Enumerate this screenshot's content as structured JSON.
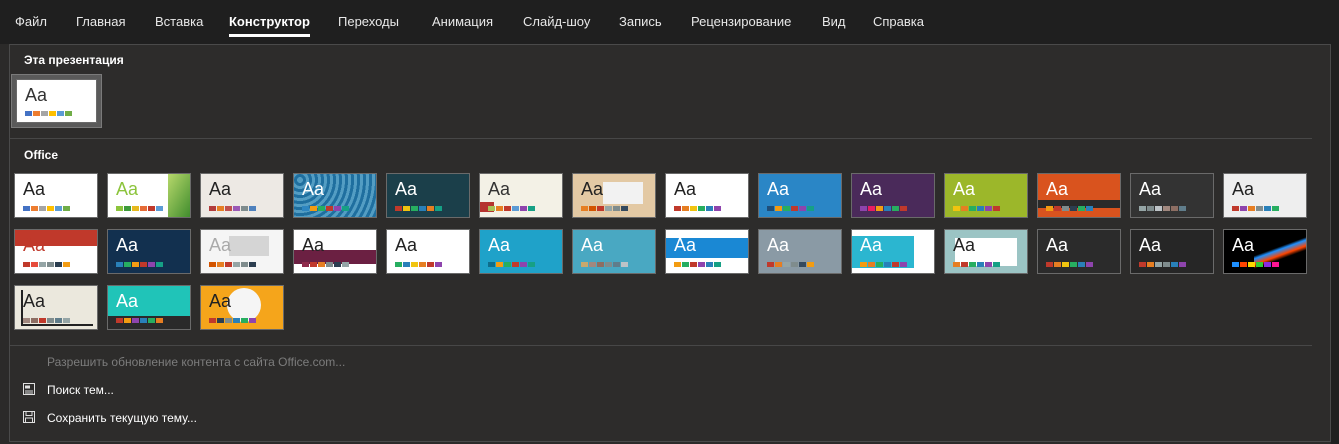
{
  "ribbon": {
    "tabs": [
      {
        "label": "Файл",
        "active": false
      },
      {
        "label": "Главная",
        "active": false
      },
      {
        "label": "Вставка",
        "active": false
      },
      {
        "label": "Конструктор",
        "active": true
      },
      {
        "label": "Переходы",
        "active": false
      },
      {
        "label": "Анимация",
        "active": false
      },
      {
        "label": "Слайд-шоу",
        "active": false
      },
      {
        "label": "Запись",
        "active": false
      },
      {
        "label": "Рецензирование",
        "active": false
      },
      {
        "label": "Вид",
        "active": false
      },
      {
        "label": "Справка",
        "active": false
      }
    ]
  },
  "gallery": {
    "this_presentation": {
      "title": "Эта презентация",
      "theme": {
        "bg": "#ffffff",
        "fg": "#333333",
        "accents": [
          "#4472c4",
          "#ed7d31",
          "#a5a5a5",
          "#ffc000",
          "#5b9bd5",
          "#70ad47"
        ]
      }
    },
    "office": {
      "title": "Office",
      "themes": [
        {
          "bg": "#ffffff",
          "fg": "#222222",
          "accents": [
            "#4472c4",
            "#ed7d31",
            "#a5a5a5",
            "#ffc000",
            "#5b9bd5",
            "#70ad47"
          ]
        },
        {
          "bg": "#ffffff",
          "fg": "#8cc43c",
          "accents": [
            "#8cc43c",
            "#3e9b3a",
            "#e6b91e",
            "#e66c37",
            "#c0392b",
            "#5b9bd5"
          ],
          "deco": "green-right"
        },
        {
          "bg": "#ede9e4",
          "fg": "#222222",
          "accents": [
            "#b23c3c",
            "#e67e22",
            "#c0504d",
            "#9b59b6",
            "#7f8c8d",
            "#4f81bd"
          ]
        },
        {
          "bg": "#1f6f9f",
          "fg": "#ffffff",
          "accents": [
            "#2e86c1",
            "#f39c12",
            "#27ae60",
            "#c0392b",
            "#8e44ad",
            "#16a085"
          ],
          "deco": "pattern-blue"
        },
        {
          "bg": "#1b3f4a",
          "fg": "#ffffff",
          "accents": [
            "#c0392b",
            "#f1c40f",
            "#27ae60",
            "#2980b9",
            "#e67e22",
            "#16a085"
          ]
        },
        {
          "bg": "#f3f1e6",
          "fg": "#333333",
          "accents": [
            "#a8c256",
            "#e67e22",
            "#c0392b",
            "#5b9bd5",
            "#8e44ad",
            "#16a085"
          ],
          "deco": "red-left"
        },
        {
          "bg": "#e3c9a4",
          "fg": "#222222",
          "accents": [
            "#e67e22",
            "#d35400",
            "#c0392b",
            "#95a5a6",
            "#7f8c8d",
            "#34495e"
          ],
          "deco": "gray-band"
        },
        {
          "bg": "#ffffff",
          "fg": "#222222",
          "accents": [
            "#c0392b",
            "#e67e22",
            "#f1c40f",
            "#27ae60",
            "#2980b9",
            "#8e44ad"
          ]
        },
        {
          "bg": "#2a86c6",
          "fg": "#ffffff",
          "accents": [
            "#1f4e79",
            "#f39c12",
            "#27ae60",
            "#c0392b",
            "#8e44ad",
            "#16a085"
          ]
        },
        {
          "bg": "#4a2a5a",
          "fg": "#ffffff",
          "accents": [
            "#8e44ad",
            "#e91e63",
            "#f39c12",
            "#2980b9",
            "#27ae60",
            "#c0392b"
          ]
        },
        {
          "bg": "#9cb72a",
          "fg": "#ffffff",
          "accents": [
            "#f1c40f",
            "#e67e22",
            "#27ae60",
            "#2980b9",
            "#8e44ad",
            "#c0392b"
          ]
        },
        {
          "bg": "#d9531e",
          "fg": "#ffffff",
          "accents": [
            "#f39c12",
            "#c0392b",
            "#7f8c8d",
            "#2c3e50",
            "#27ae60",
            "#2980b9"
          ],
          "deco": "dark-band"
        },
        {
          "bg": "#333333",
          "fg": "#ffffff",
          "accents": [
            "#95a5a6",
            "#7f8c8d",
            "#bdc3c7",
            "#a1887f",
            "#8d6e63",
            "#607d8b"
          ]
        },
        {
          "bg": "#eeeeee",
          "fg": "#222222",
          "accents": [
            "#c0392b",
            "#8e44ad",
            "#e67e22",
            "#7f8c8d",
            "#2980b9",
            "#27ae60"
          ]
        },
        {
          "bg": "#ffffff",
          "fg": "#c0392b",
          "accents": [
            "#c0392b",
            "#e74c3c",
            "#95a5a6",
            "#7f8c8d",
            "#2c3e50",
            "#f39c12"
          ],
          "deco": "red-block"
        },
        {
          "bg": "#12304f",
          "fg": "#ffffff",
          "accents": [
            "#2980b9",
            "#27ae60",
            "#f39c12",
            "#c0392b",
            "#8e44ad",
            "#16a085"
          ]
        },
        {
          "bg": "#f5f5f5",
          "fg": "#aaaaaa",
          "accents": [
            "#d35400",
            "#e67e22",
            "#c0392b",
            "#95a5a6",
            "#7f8c8d",
            "#2c3e50"
          ],
          "deco": "gray-block"
        },
        {
          "bg": "#ffffff",
          "fg": "#222222",
          "accents": [
            "#8e2a4a",
            "#c0392b",
            "#e67e22",
            "#7f8c8d",
            "#2c3e50",
            "#95a5a6"
          ],
          "deco": "maroon-band"
        },
        {
          "bg": "#ffffff",
          "fg": "#222222",
          "accents": [
            "#27ae60",
            "#2980b9",
            "#f1c40f",
            "#e67e22",
            "#c0392b",
            "#8e44ad"
          ]
        },
        {
          "bg": "#1fa2c9",
          "fg": "#ffffff",
          "accents": [
            "#0e6e8c",
            "#f39c12",
            "#27ae60",
            "#c0392b",
            "#8e44ad",
            "#16a085"
          ]
        },
        {
          "bg": "#49a8c2",
          "fg": "#ffffff",
          "accents": [
            "#c8a96e",
            "#a1887f",
            "#8d6e63",
            "#7f8c8d",
            "#607d8b",
            "#bdc3c7"
          ]
        },
        {
          "bg": "#ffffff",
          "fg": "#ffffff",
          "accents": [
            "#f39c12",
            "#27ae60",
            "#c0392b",
            "#8e44ad",
            "#2980b9",
            "#16a085"
          ],
          "deco": "blue-band"
        },
        {
          "bg": "#8a9aa5",
          "fg": "#ffffff",
          "accents": [
            "#c0392b",
            "#e67e22",
            "#95a5a6",
            "#7f8c8d",
            "#34495e",
            "#f39c12"
          ]
        },
        {
          "bg": "#ffffff",
          "fg": "#ffffff",
          "accents": [
            "#f39c12",
            "#e67e22",
            "#27ae60",
            "#2980b9",
            "#c0392b",
            "#8e44ad"
          ],
          "deco": "teal-left"
        },
        {
          "bg": "#9bc4c4",
          "fg": "#222222",
          "accents": [
            "#e67e22",
            "#c0392b",
            "#27ae60",
            "#2980b9",
            "#8e44ad",
            "#16a085"
          ],
          "deco": "white-box"
        },
        {
          "bg": "#2b2b2b",
          "fg": "#ffffff",
          "accents": [
            "#c0392b",
            "#e67e22",
            "#f1c40f",
            "#27ae60",
            "#2980b9",
            "#8e44ad"
          ]
        },
        {
          "bg": "#262626",
          "fg": "#ffffff",
          "accents": [
            "#c0392b",
            "#e67e22",
            "#95a5a6",
            "#7f8c8d",
            "#2980b9",
            "#8e44ad"
          ]
        },
        {
          "bg": "#000000",
          "fg": "#ffffff",
          "accents": [
            "#1e90ff",
            "#ff4500",
            "#ffd700",
            "#32cd32",
            "#8a2be2",
            "#ff1493"
          ],
          "deco": "rainbow"
        },
        {
          "bg": "#ebe8dd",
          "fg": "#222222",
          "accents": [
            "#a1887f",
            "#8d6e63",
            "#c0392b",
            "#7f8c8d",
            "#607d8b",
            "#95a5a6"
          ],
          "deco": "bracket"
        },
        {
          "bg": "#20c4b8",
          "fg": "#ffffff",
          "accents": [
            "#c0392b",
            "#f39c12",
            "#8e44ad",
            "#2980b9",
            "#27ae60",
            "#e67e22"
          ],
          "deco": "dark-bottom"
        },
        {
          "bg": "#f5a51b",
          "fg": "#222222",
          "accents": [
            "#c0392b",
            "#2c3e50",
            "#7f8c8d",
            "#2980b9",
            "#27ae60",
            "#8e44ad"
          ],
          "deco": "white-circle"
        }
      ]
    }
  },
  "commands": {
    "allow_update": "Разрешить обновление контента с сайта Office.com...",
    "browse": "Поиск тем...",
    "save": "Сохранить текущую тему..."
  }
}
